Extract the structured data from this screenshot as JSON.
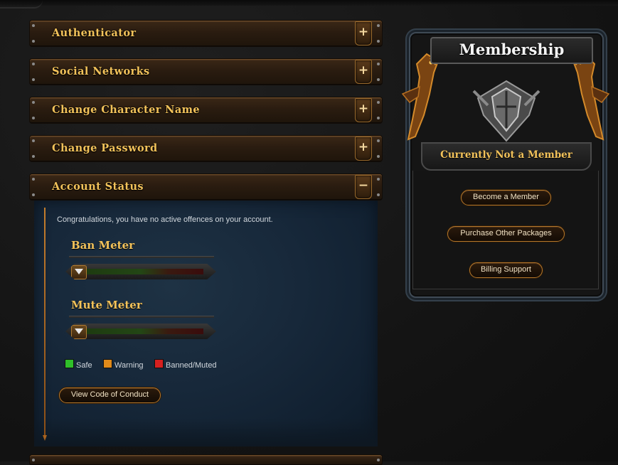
{
  "accordion": [
    {
      "title": "Authenticator",
      "toggle": "+"
    },
    {
      "title": "Social Networks",
      "toggle": "+"
    },
    {
      "title": "Change Character Name",
      "toggle": "+"
    },
    {
      "title": "Change Password",
      "toggle": "+"
    },
    {
      "title": "Account Status",
      "toggle": "−"
    }
  ],
  "account_status": {
    "message": "Congratulations, you have no active offences on your account.",
    "ban_meter": {
      "label": "Ban Meter",
      "value": 0
    },
    "mute_meter": {
      "label": "Mute Meter",
      "value": 0
    },
    "legend": [
      {
        "label": "Safe",
        "color": "#2fbf2a"
      },
      {
        "label": "Warning",
        "color": "#e08a1a"
      },
      {
        "label": "Banned/Muted",
        "color": "#d62020"
      }
    ],
    "conduct_button": "View Code of Conduct"
  },
  "membership": {
    "title": "Membership",
    "status": "Currently Not a Member",
    "buttons": [
      "Become a Member",
      "Purchase Other Packages",
      "Billing Support"
    ]
  },
  "colors": {
    "accent_gold": "#f2c25a",
    "panel_blue": "#17283a",
    "button_border": "#b4772c"
  }
}
